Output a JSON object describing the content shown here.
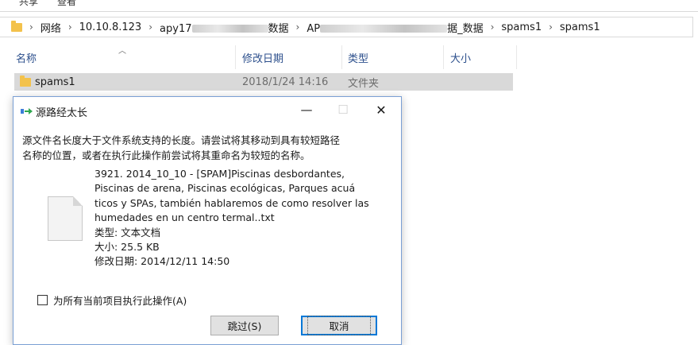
{
  "ribbon": {
    "tabs": [
      "共享",
      "查看"
    ]
  },
  "address_bar": {
    "crumbs": [
      "网络",
      "10.10.8.123",
      "apy17",
      "数据",
      "AP",
      "据_数据",
      "spams1",
      "spams1"
    ]
  },
  "columns": {
    "name": "名称",
    "date": "修改日期",
    "type": "类型",
    "size": "大小"
  },
  "files": [
    {
      "name": "spams1",
      "date": "2018/1/24 14:16",
      "type": "文件夹"
    }
  ],
  "dialog": {
    "title": "源路经太长",
    "controls": {
      "minimize": "—",
      "maximize": "☐",
      "close": "✕"
    },
    "message_line1": "源文件名长度大于文件系统支持的长度。请尝试将其移动到具有较短路径",
    "message_line2": "名称的位置，或者在执行此操作前尝试将其重命名为较短的名称。",
    "file": {
      "lines": [
        "3921. 2014_10_10 - [SPAM]Piscinas desbordantes,",
        "Piscinas de arena, Piscinas ecológicas, Parques acuá",
        "ticos y SPAs, también hablaremos de como resolver las",
        "humedades en un centro termal..txt"
      ],
      "type_line": "类型: 文本文档",
      "size_line": "大小: 25.5 KB",
      "date_line": "修改日期: 2014/12/11 14:50"
    },
    "checkbox_label": "为所有当前项目执行此操作(A)",
    "skip_label": "跳过(S)",
    "cancel_label": "取消"
  },
  "colors": {
    "accent": "#0078d7",
    "folder": "#f3c24c",
    "header_text": "#2c4f8c"
  }
}
